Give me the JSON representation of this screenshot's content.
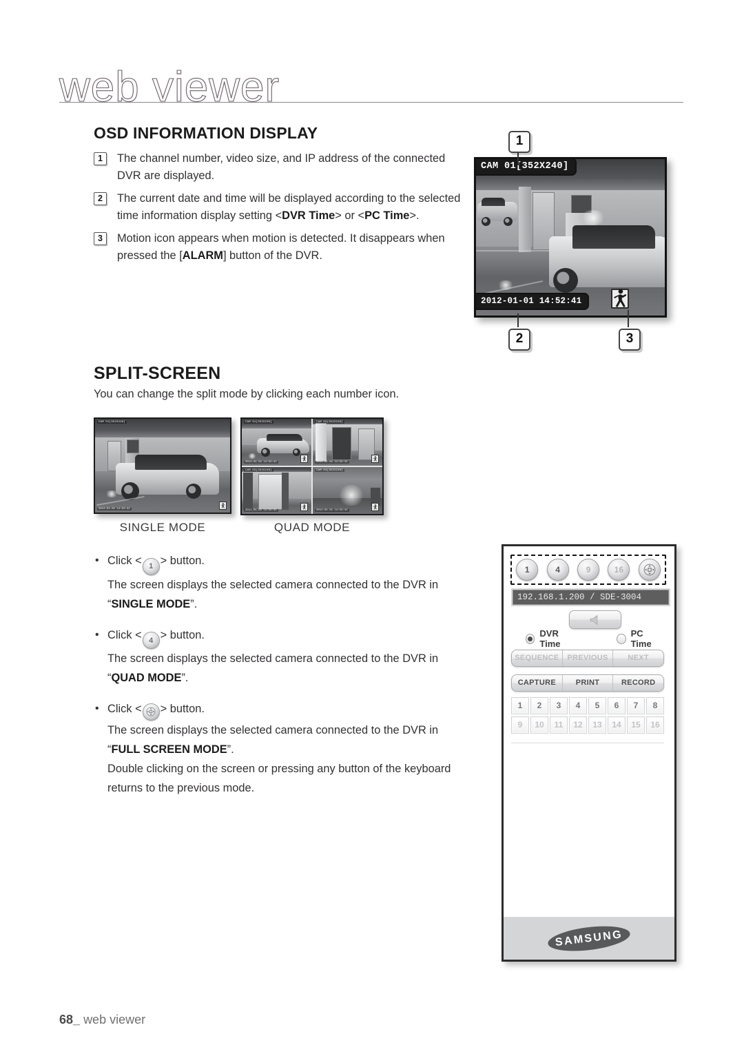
{
  "header": {
    "title": "web viewer"
  },
  "osd_section": {
    "heading": "OSD INFORMATION DISPLAY",
    "items": [
      {
        "num": "1",
        "text_before": "The channel number, video size, and IP address of the connected DVR are displayed.",
        "bold_a": "",
        "text_mid": "",
        "bold_b": "",
        "text_after": ""
      },
      {
        "num": "2",
        "text_before": "The current date and time will be displayed according to the selected time information display setting <",
        "bold_a": "DVR Time",
        "text_mid": "> or <",
        "bold_b": "PC Time",
        "text_after": ">."
      },
      {
        "num": "3",
        "text_before": "Motion icon appears when motion is detected. It disappears when pressed the [",
        "bold_a": "ALARM",
        "text_mid": "] button of the DVR.",
        "bold_b": "",
        "text_after": ""
      }
    ]
  },
  "cctv": {
    "osd_cam_label": "CAM 01[352X240]",
    "osd_timestamp": "2012-01-01 14:52:41",
    "motion_icon": "walking-person-icon",
    "callouts": {
      "one": "1",
      "two": "2",
      "three": "3"
    }
  },
  "split_section": {
    "heading": "SPLIT-SCREEN",
    "intro": "You can change the split mode by clicking each number icon.",
    "thumbs": [
      {
        "label": "SINGLE MODE",
        "osd_top": "CAM 01[352X240]",
        "osd_bottom": "2012-01-01  14:52:41"
      },
      {
        "label": "QUAD MODE",
        "osd_top": "CAM 01[352X240]",
        "osd_bottom": "2012-01-01  14:52:41"
      }
    ],
    "quad_osd": [
      {
        "top": "CAM 01[352X240]",
        "bottom": "2012-01-01  14:52:41"
      },
      {
        "top": "CAM 02[352X240]",
        "bottom": "2012-01-01  14:52:41"
      },
      {
        "top": "CAM 03[352X240]",
        "bottom": "2012-01-01  14:52:41"
      },
      {
        "top": "CAM 04[352X240]",
        "bottom": "2012-01-01  14:52:41"
      }
    ],
    "bullets": [
      {
        "click_prefix": "Click <",
        "icon": "1",
        "icon_name": "single-mode-icon",
        "click_suffix": "> button.",
        "desc": "The screen displays the selected camera connected to the DVR in",
        "quote_open": "“",
        "mode": "SINGLE MODE",
        "quote_close": "”.",
        "extra_1": "",
        "extra_2": ""
      },
      {
        "click_prefix": "Click <",
        "icon": "4",
        "icon_name": "quad-mode-icon",
        "click_suffix": "> button.",
        "desc": "The screen displays the selected camera connected to the DVR in",
        "quote_open": "“",
        "mode": "QUAD MODE",
        "quote_close": "”.",
        "extra_1": "",
        "extra_2": ""
      },
      {
        "click_prefix": "Click <",
        "icon": "fullscreen-arrows-icon",
        "icon_name": "full-screen-mode-icon",
        "click_suffix": "> button.",
        "desc": "The screen displays the selected camera connected to the DVR in",
        "quote_open": "“",
        "mode": "FULL SCREEN MODE",
        "quote_close": "”.",
        "extra_1": "Double clicking on the screen or pressing any button of the keyboard",
        "extra_2": "returns to the previous mode."
      }
    ]
  },
  "control_panel": {
    "split_buttons": [
      {
        "label": "1",
        "name": "split-1-button",
        "enabled": true
      },
      {
        "label": "4",
        "name": "split-4-button",
        "enabled": true
      },
      {
        "label": "9",
        "name": "split-9-button",
        "enabled": false
      },
      {
        "label": "16",
        "name": "split-16-button",
        "enabled": false
      },
      {
        "label": "",
        "name": "full-screen-button",
        "enabled": true
      }
    ],
    "address_value": "192.168.1.200   / SDE-3004",
    "audio_button_icon": "speaker-icon",
    "time_options": [
      {
        "label": "DVR Time",
        "selected": true
      },
      {
        "label": "PC Time",
        "selected": false
      }
    ],
    "nav_buttons": [
      {
        "label": "SEQUENCE",
        "disabled": true
      },
      {
        "label": "PREVIOUS",
        "disabled": true
      },
      {
        "label": "NEXT",
        "disabled": true
      }
    ],
    "action_buttons": [
      {
        "label": "CAPTURE",
        "disabled": false
      },
      {
        "label": "PRINT",
        "disabled": false
      },
      {
        "label": "RECORD",
        "disabled": false
      }
    ],
    "channels_row1": [
      "1",
      "2",
      "3",
      "4",
      "5",
      "6",
      "7",
      "8"
    ],
    "channels_row2": [
      "9",
      "10",
      "11",
      "12",
      "13",
      "14",
      "15",
      "16"
    ],
    "brand": "SAMSUNG"
  },
  "footer": {
    "page_number": "68",
    "underscore": "_",
    "section": "web viewer"
  }
}
